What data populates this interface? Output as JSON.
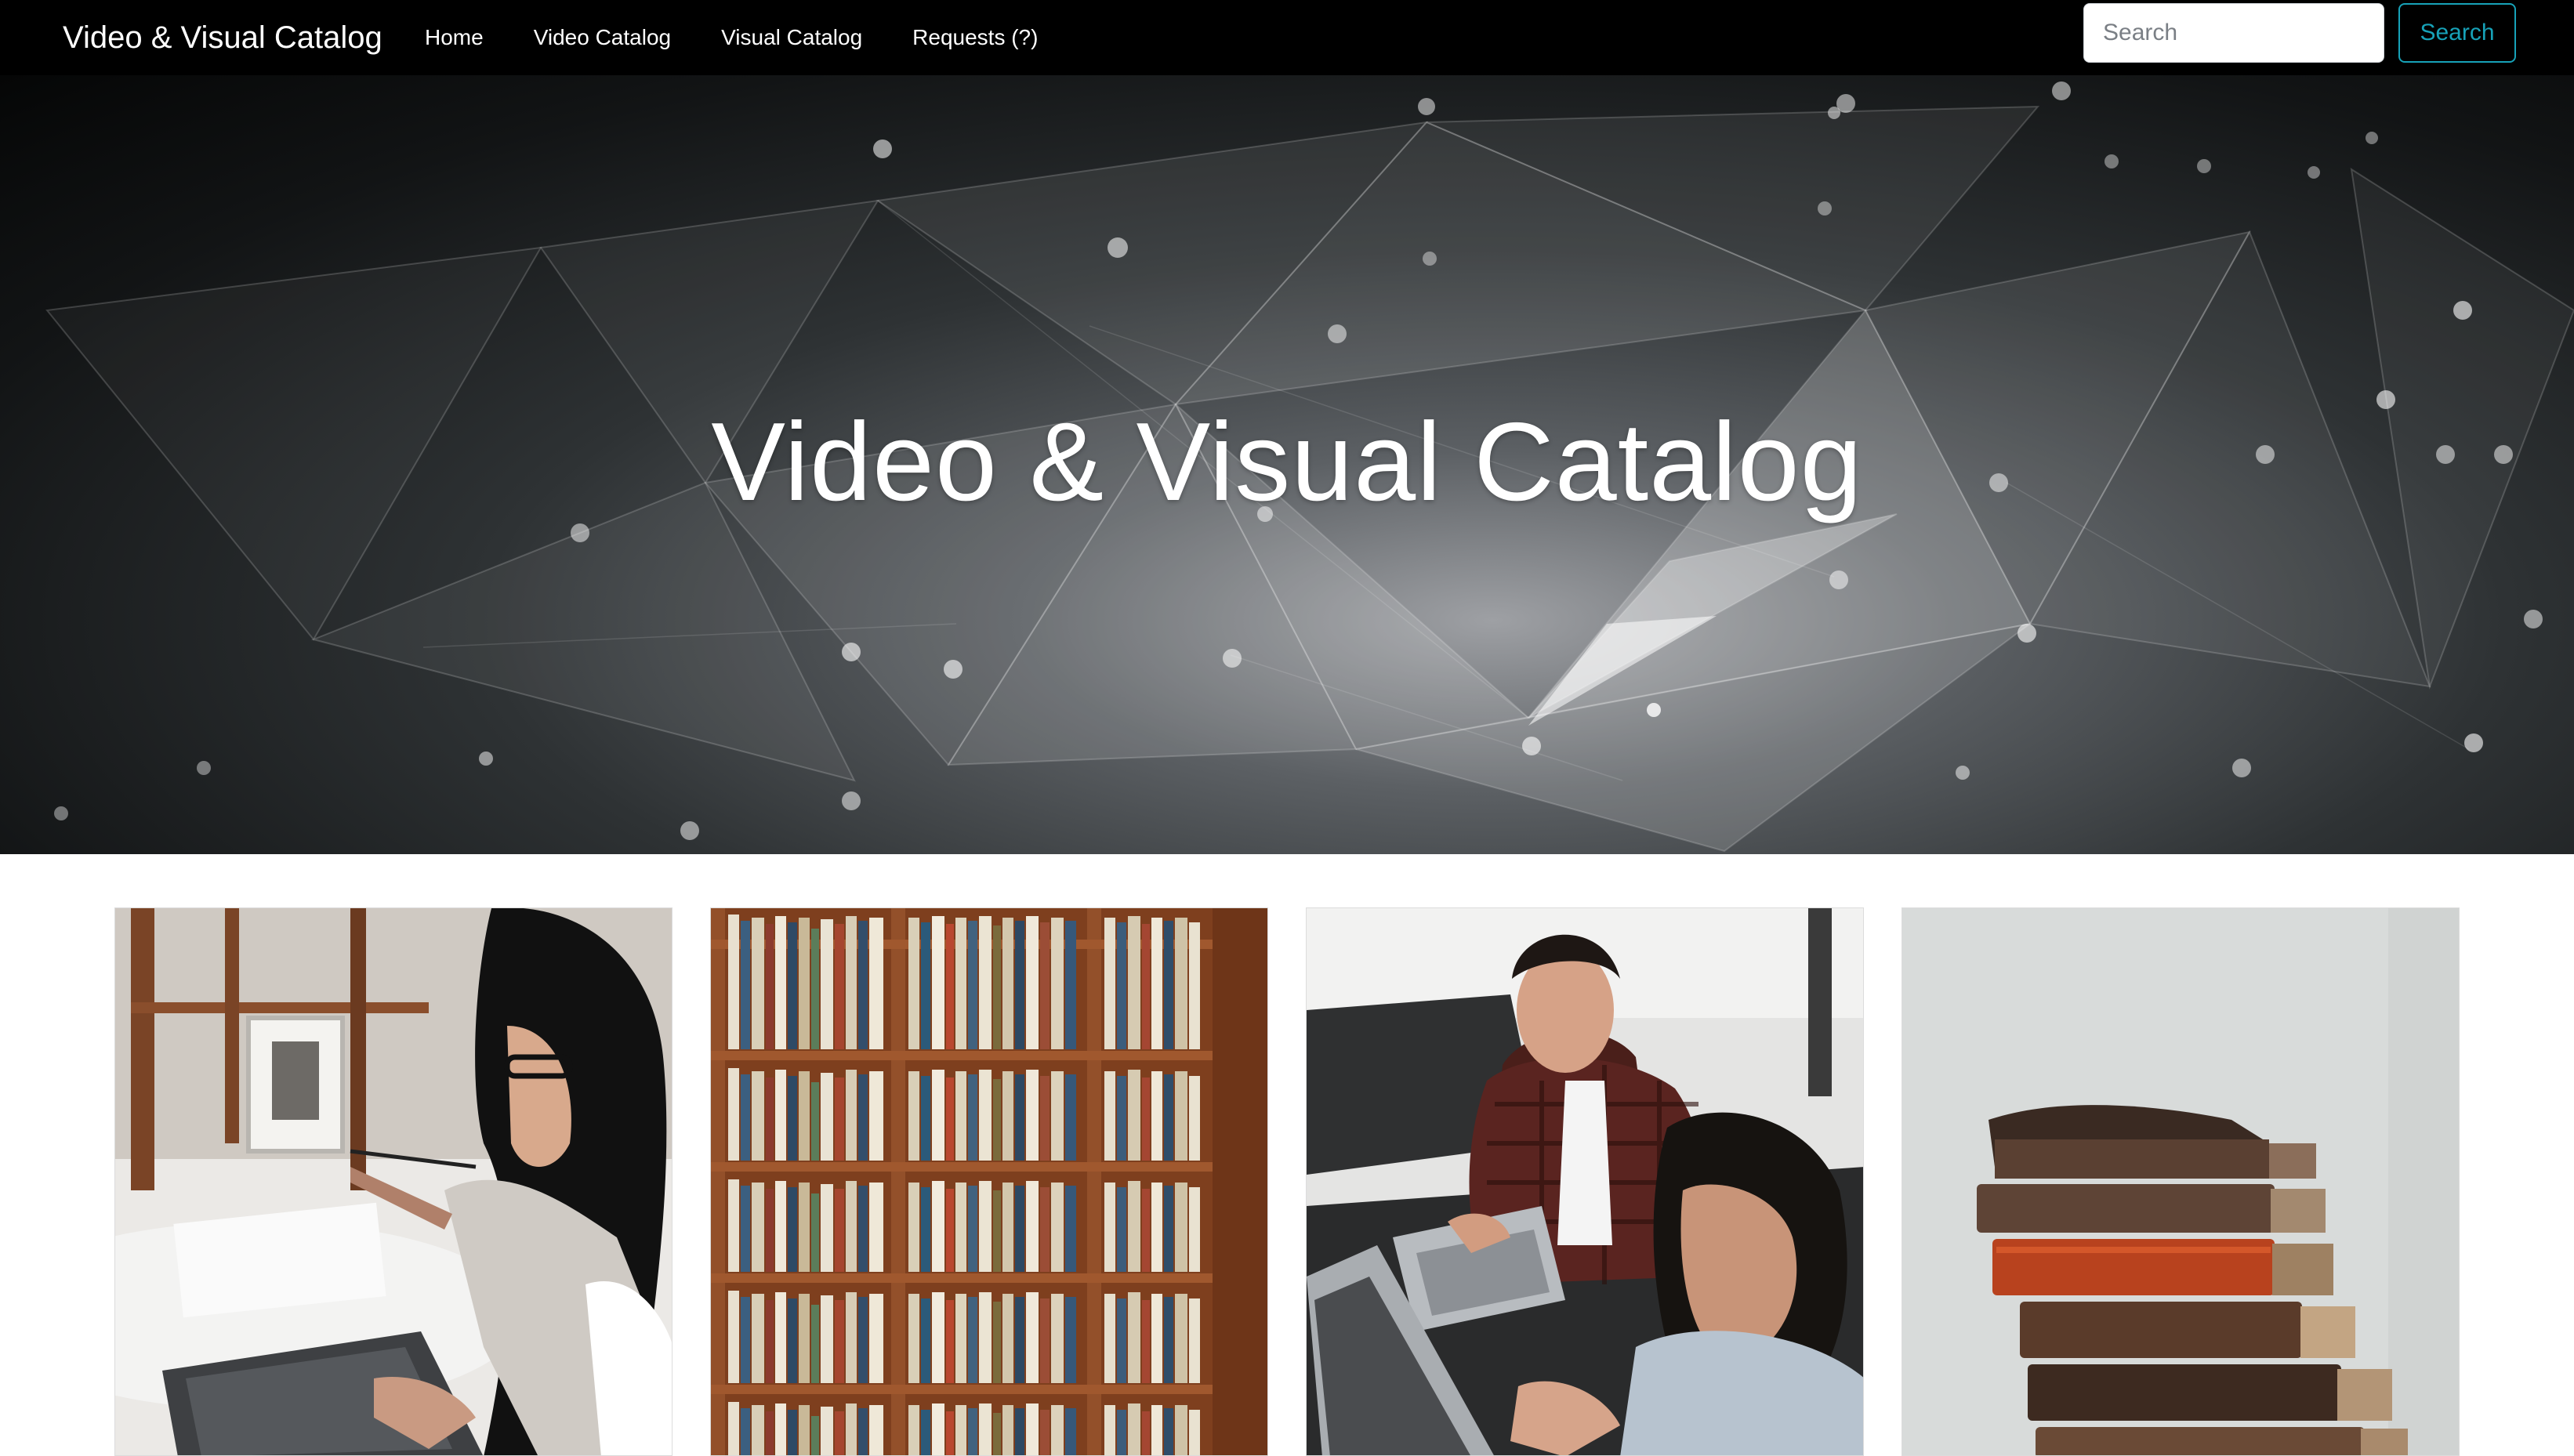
{
  "navbar": {
    "brand": "Video & Visual Catalog",
    "links": [
      {
        "label": "Home"
      },
      {
        "label": "Video Catalog"
      },
      {
        "label": "Visual Catalog"
      },
      {
        "label": "Requests (?)"
      }
    ],
    "search": {
      "placeholder": "Search",
      "button_label": "Search"
    }
  },
  "hero": {
    "title": "Video & Visual Catalog",
    "background_icon": "low-poly-network-pattern"
  },
  "cards": [
    {
      "image": "woman-studying-with-laptop-image"
    },
    {
      "image": "library-bookshelf-image"
    },
    {
      "image": "students-working-on-laptops-image"
    },
    {
      "image": "stack-of-old-books-image"
    }
  ],
  "colors": {
    "navbar_bg": "#000000",
    "accent": "#17a2b8",
    "text_light": "#ffffff"
  }
}
